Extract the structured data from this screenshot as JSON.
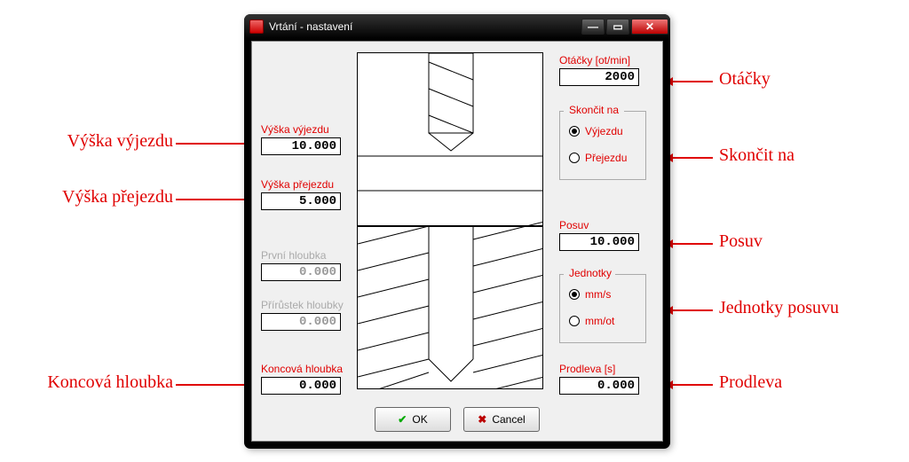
{
  "window": {
    "title": "Vrtání - nastavení"
  },
  "left": {
    "vyska_vyjezdu": {
      "label": "Výška výjezdu",
      "value": "10.000"
    },
    "vyska_prejezdu": {
      "label": "Výška přejezdu",
      "value": "5.000"
    },
    "prvni_hloubka": {
      "label": "První hloubka",
      "value": "0.000"
    },
    "prirustek": {
      "label": "Přírůstek hloubky",
      "value": "0.000"
    },
    "koncova": {
      "label": "Koncová hloubka",
      "value": "0.000"
    }
  },
  "right": {
    "otacky": {
      "label": "Otáčky [ot/min]",
      "value": "2000"
    },
    "skoncit": {
      "label": "Skončit na",
      "opt1": "Výjezdu",
      "opt2": "Přejezdu",
      "selected": "vyjezdu"
    },
    "posuv": {
      "label": "Posuv",
      "value": "10.000"
    },
    "jednotky": {
      "label": "Jednotky",
      "opt1": "mm/s",
      "opt2": "mm/ot",
      "selected": "mms"
    },
    "prodleva": {
      "label": "Prodleva [s]",
      "value": "0.000"
    }
  },
  "buttons": {
    "ok": "OK",
    "cancel": "Cancel"
  },
  "callouts": {
    "l1": "Výška výjezdu",
    "l2": "Výška přejezdu",
    "l3": "Koncová hloubka",
    "r1": "Otáčky",
    "r2": "Skončit na",
    "r3": "Posuv",
    "r4": "Jednotky posuvu",
    "r5": "Prodleva"
  }
}
